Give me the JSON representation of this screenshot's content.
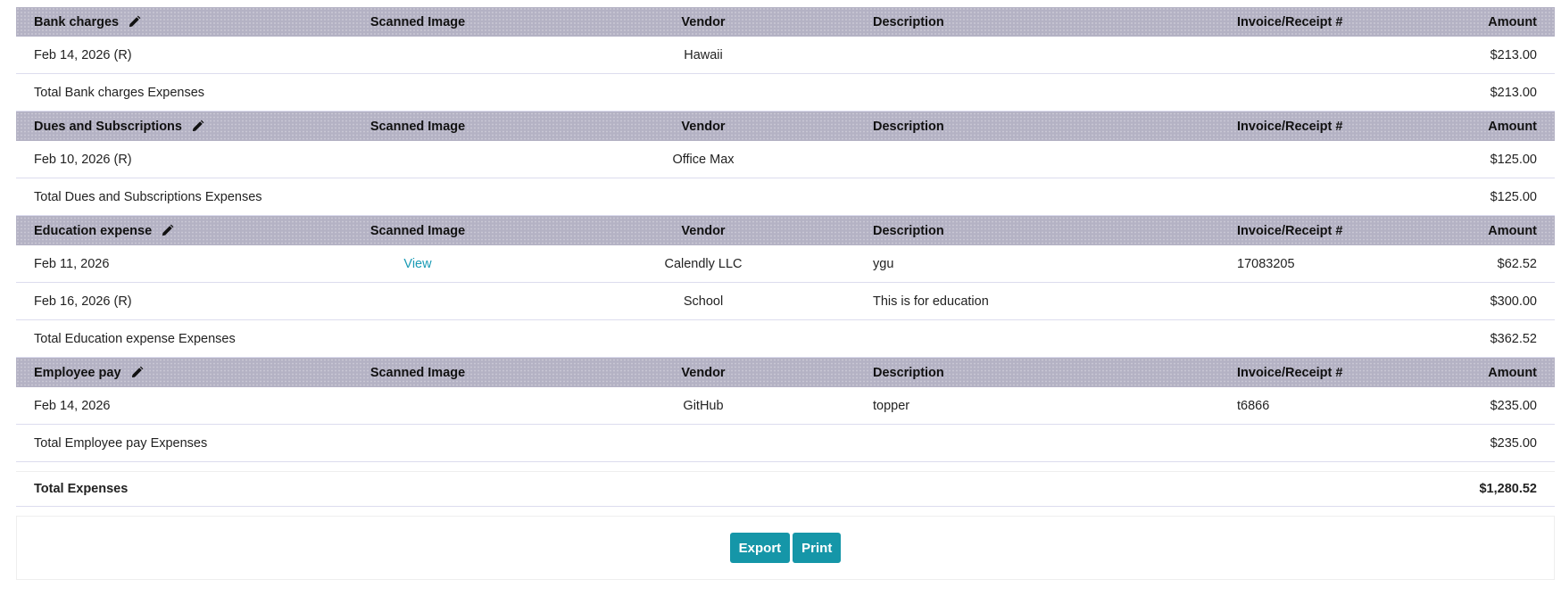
{
  "columns": {
    "scanned_image": "Scanned Image",
    "vendor": "Vendor",
    "description": "Description",
    "invoice": "Invoice/Receipt #",
    "amount": "Amount"
  },
  "categories": [
    {
      "name": "Bank charges",
      "rows": [
        {
          "date": "Feb 14, 2026 (R)",
          "scanned_image": "",
          "vendor": "Hawaii",
          "description": "",
          "invoice": "",
          "amount": "$213.00"
        }
      ],
      "total_label": "Total Bank charges Expenses",
      "total_amount": "$213.00"
    },
    {
      "name": "Dues and Subscriptions",
      "rows": [
        {
          "date": "Feb 10, 2026 (R)",
          "scanned_image": "",
          "vendor": "Office Max",
          "description": "",
          "invoice": "",
          "amount": "$125.00"
        }
      ],
      "total_label": "Total Dues and Subscriptions Expenses",
      "total_amount": "$125.00"
    },
    {
      "name": "Education expense",
      "rows": [
        {
          "date": "Feb 11, 2026",
          "scanned_image": "View",
          "vendor": "Calendly LLC",
          "description": "ygu",
          "invoice": "17083205",
          "amount": "$62.52"
        },
        {
          "date": "Feb 16, 2026 (R)",
          "scanned_image": "",
          "vendor": "School",
          "description": "This is for education",
          "invoice": "",
          "amount": "$300.00"
        }
      ],
      "total_label": "Total Education expense Expenses",
      "total_amount": "$362.52"
    },
    {
      "name": "Employee pay",
      "rows": [
        {
          "date": "Feb 14, 2026",
          "scanned_image": "",
          "vendor": "GitHub",
          "description": "topper",
          "invoice": "t6866",
          "amount": "$235.00"
        }
      ],
      "total_label": "Total Employee pay Expenses",
      "total_amount": "$235.00"
    }
  ],
  "grand_total": {
    "label": "Total Expenses",
    "amount": "$1,280.52"
  },
  "buttons": {
    "export": "Export",
    "print": "Print"
  },
  "icons": {
    "edit": "pencil-icon"
  },
  "colors": {
    "header_bg": "#b4b2c4",
    "button_bg": "#1596a8",
    "link": "#1a9bb5",
    "row_border": "#dcdcee"
  }
}
